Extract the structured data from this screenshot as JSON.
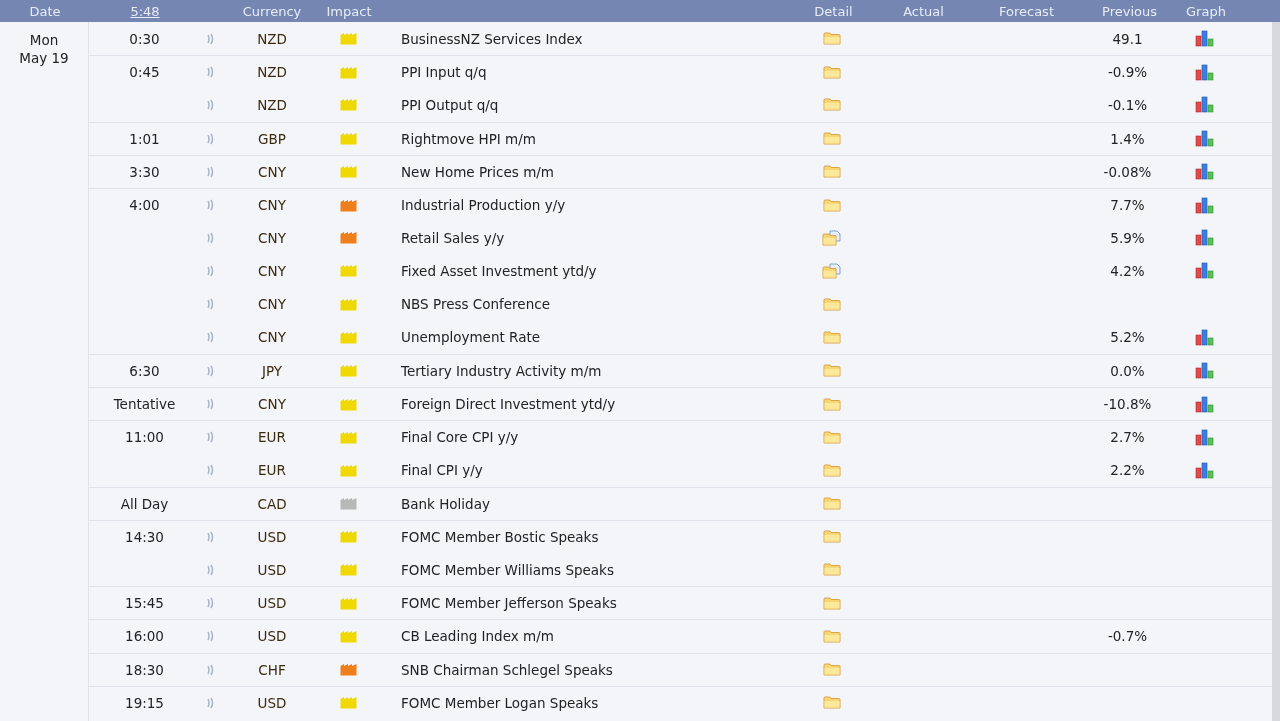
{
  "header": {
    "date": "Date",
    "clock": "5:48",
    "currency": "Currency",
    "impact": "Impact",
    "detail": "Detail",
    "actual": "Actual",
    "forecast": "Forecast",
    "previous": "Previous",
    "graph": "Graph"
  },
  "day": {
    "weekday": "Mon",
    "date": "May 19"
  },
  "events": [
    {
      "time": "0:30",
      "sound": true,
      "currency": "NZD",
      "color": "#efd900",
      "event": "BusinessNZ Services Index",
      "detail_document": false,
      "previous": "49.1",
      "graph": true
    },
    {
      "time": "0:45",
      "sound": true,
      "currency": "NZD",
      "color": "#efd900",
      "event": "PPI Input q/q",
      "detail_document": false,
      "previous": "-0.9%",
      "graph": true
    },
    {
      "sound": true,
      "currency": "NZD",
      "color": "#efd900",
      "event": "PPI Output q/q",
      "detail_document": false,
      "previous": "-0.1%",
      "graph": true
    },
    {
      "time": "1:01",
      "sound": true,
      "currency": "GBP",
      "color": "#efd900",
      "event": "Rightmove HPI m/m",
      "detail_document": false,
      "previous": "1.4%",
      "graph": true
    },
    {
      "time": "3:30",
      "sound": true,
      "currency": "CNY",
      "color": "#efd900",
      "event": "New Home Prices m/m",
      "detail_document": false,
      "previous": "-0.08%",
      "graph": true
    },
    {
      "time": "4:00",
      "sound": true,
      "currency": "CNY",
      "color": "#ef7f1a",
      "event": "Industrial Production y/y",
      "detail_document": false,
      "previous": "7.7%",
      "graph": true
    },
    {
      "sound": true,
      "currency": "CNY",
      "color": "#ef7f1a",
      "event": "Retail Sales y/y",
      "detail_document": true,
      "previous": "5.9%",
      "graph": true
    },
    {
      "sound": true,
      "currency": "CNY",
      "color": "#efd900",
      "event": "Fixed Asset Investment ytd/y",
      "detail_document": true,
      "previous": "4.2%",
      "graph": true
    },
    {
      "sound": true,
      "currency": "CNY",
      "color": "#efd900",
      "event": "NBS Press Conference",
      "detail_document": false,
      "graph": false
    },
    {
      "sound": true,
      "currency": "CNY",
      "color": "#efd900",
      "event": "Unemployment Rate",
      "detail_document": false,
      "previous": "5.2%",
      "graph": true
    },
    {
      "time": "6:30",
      "sound": true,
      "currency": "JPY",
      "color": "#efd900",
      "event": "Tertiary Industry Activity m/m",
      "detail_document": false,
      "previous": "0.0%",
      "graph": true
    },
    {
      "time": "Tentative",
      "sound": true,
      "currency": "CNY",
      "color": "#efd900",
      "event": "Foreign Direct Investment ytd/y",
      "detail_document": false,
      "previous": "-10.8%",
      "graph": true
    },
    {
      "time": "11:00",
      "sound": true,
      "currency": "EUR",
      "color": "#efd900",
      "event": "Final Core CPI y/y",
      "detail_document": false,
      "previous": "2.7%",
      "graph": true
    },
    {
      "sound": true,
      "currency": "EUR",
      "color": "#efd900",
      "event": "Final CPI y/y",
      "detail_document": false,
      "previous": "2.2%",
      "graph": true
    },
    {
      "time": "All Day",
      "sound": false,
      "currency": "CAD",
      "color": "#b8b8b8",
      "event": "Bank Holiday",
      "detail_document": false,
      "graph": false
    },
    {
      "time": "14:30",
      "sound": true,
      "currency": "USD",
      "color": "#efd900",
      "event": "FOMC Member Bostic Speaks",
      "detail_document": false,
      "graph": false
    },
    {
      "sound": true,
      "currency": "USD",
      "color": "#efd900",
      "event": "FOMC Member Williams Speaks",
      "detail_document": false,
      "graph": false
    },
    {
      "time": "15:45",
      "sound": true,
      "currency": "USD",
      "color": "#efd900",
      "event": "FOMC Member Jefferson Speaks",
      "detail_document": false,
      "graph": false
    },
    {
      "time": "16:00",
      "sound": true,
      "currency": "USD",
      "color": "#efd900",
      "event": "CB Leading Index m/m",
      "detail_document": false,
      "previous": "-0.7%",
      "graph": false
    },
    {
      "time": "18:30",
      "sound": true,
      "currency": "CHF",
      "color": "#ef7f1a",
      "event": "SNB Chairman Schlegel Speaks",
      "detail_document": false,
      "graph": false
    },
    {
      "time": "19:15",
      "sound": true,
      "currency": "USD",
      "color": "#efd900",
      "event": "FOMC Member Logan Speaks",
      "detail_document": false,
      "graph": false
    }
  ]
}
